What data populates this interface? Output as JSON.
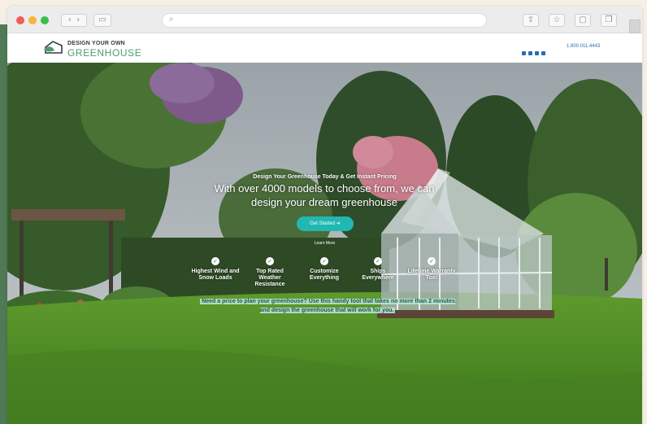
{
  "browser": {
    "nav_back_icon": "chevron-left-icon",
    "nav_forward_icon": "chevron-right-icon",
    "address_placeholder": "",
    "toolbar_icons": [
      "share-icon",
      "star-icon",
      "extensions-icon",
      "tabs-icon"
    ]
  },
  "header": {
    "logo_top": "DESIGN YOUR OWN",
    "logo_bottom": "GREENHOUSE",
    "phone": "1.800.011.4443",
    "social_icons": [
      "rss-icon",
      "facebook-icon",
      "instagram-icon",
      "youtube-icon"
    ]
  },
  "hero": {
    "subtitle": "Design Your Greenhouse Today & Get Instant Pricing",
    "title": "With over 4000 models to choose from, we can design your dream greenhouse",
    "cta_label": "Get Started  ➜",
    "learn_more": "Learn More",
    "features": [
      {
        "label": "Highest Wind and Snow Loads"
      },
      {
        "label": "Top Rated Weather Resistance"
      },
      {
        "label": "Customize Everything"
      },
      {
        "label": "Ships Everywhere"
      },
      {
        "label": "Lifetime Warranty Too!"
      }
    ],
    "description": "Need a price to plan your greenhouse? Use this handy tool that takes no more than 2 minutes and design the greenhouse that will work for you."
  },
  "colors": {
    "accent": "#21b8b1",
    "brand_green": "#4f9a6e",
    "link_blue": "#2b6cb0"
  }
}
